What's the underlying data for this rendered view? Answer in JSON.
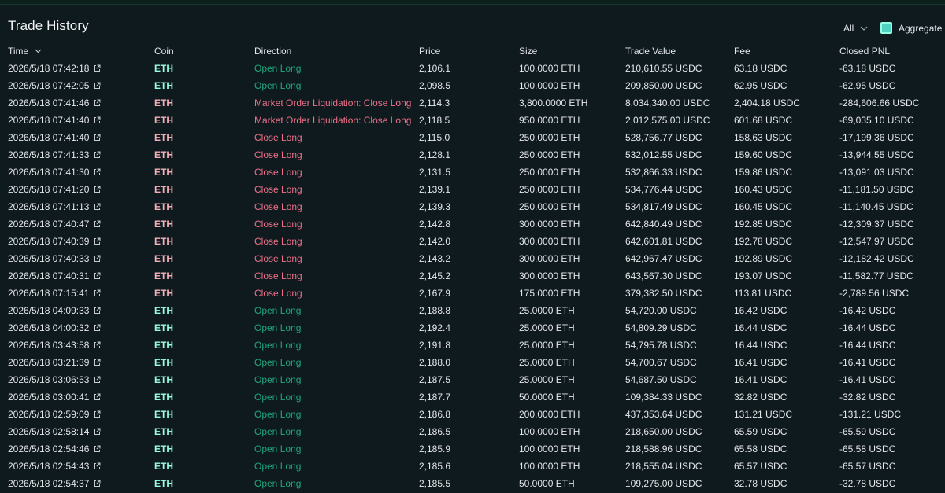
{
  "header": {
    "title": "Trade History",
    "filter_label": "All",
    "aggregate_label": "Aggregate"
  },
  "columns": {
    "time": "Time",
    "coin": "Coin",
    "direction": "Direction",
    "price": "Price",
    "size": "Size",
    "trade_value": "Trade Value",
    "fee": "Fee",
    "closed_pnl": "Closed PNL"
  },
  "colors": {
    "background": "#0f1a1f",
    "long_coin": "#97fce4",
    "short_coin": "#f6b0b7",
    "long_direction": "#1fa67d",
    "short_direction": "#ed7088",
    "accent": "#50d2c1"
  },
  "icons": {
    "external_link": "external-link-icon",
    "dropdown": "chevron-down-icon",
    "sort": "chevron-down-icon"
  },
  "rows": [
    {
      "time": "2026/5/18 07:42:18",
      "coin": "ETH",
      "direction": "Open Long",
      "side": "long",
      "price": "2,106.1",
      "size": "100.0000 ETH",
      "value": "210,610.55 USDC",
      "fee": "63.18 USDC",
      "pnl": "-63.18 USDC"
    },
    {
      "time": "2026/5/18 07:42:05",
      "coin": "ETH",
      "direction": "Open Long",
      "side": "long",
      "price": "2,098.5",
      "size": "100.0000 ETH",
      "value": "209,850.00 USDC",
      "fee": "62.95 USDC",
      "pnl": "-62.95 USDC"
    },
    {
      "time": "2026/5/18 07:41:46",
      "coin": "ETH",
      "direction": "Market Order Liquidation: Close Long",
      "side": "short",
      "price": "2,114.3",
      "size": "3,800.0000 ETH",
      "value": "8,034,340.00 USDC",
      "fee": "2,404.18 USDC",
      "pnl": "-284,606.66 USDC"
    },
    {
      "time": "2026/5/18 07:41:40",
      "coin": "ETH",
      "direction": "Market Order Liquidation: Close Long",
      "side": "short",
      "price": "2,118.5",
      "size": "950.0000 ETH",
      "value": "2,012,575.00 USDC",
      "fee": "601.68 USDC",
      "pnl": "-69,035.10 USDC"
    },
    {
      "time": "2026/5/18 07:41:40",
      "coin": "ETH",
      "direction": "Close Long",
      "side": "short",
      "price": "2,115.0",
      "size": "250.0000 ETH",
      "value": "528,756.77 USDC",
      "fee": "158.63 USDC",
      "pnl": "-17,199.36 USDC"
    },
    {
      "time": "2026/5/18 07:41:33",
      "coin": "ETH",
      "direction": "Close Long",
      "side": "short",
      "price": "2,128.1",
      "size": "250.0000 ETH",
      "value": "532,012.55 USDC",
      "fee": "159.60 USDC",
      "pnl": "-13,944.55 USDC"
    },
    {
      "time": "2026/5/18 07:41:30",
      "coin": "ETH",
      "direction": "Close Long",
      "side": "short",
      "price": "2,131.5",
      "size": "250.0000 ETH",
      "value": "532,866.33 USDC",
      "fee": "159.86 USDC",
      "pnl": "-13,091.03 USDC"
    },
    {
      "time": "2026/5/18 07:41:20",
      "coin": "ETH",
      "direction": "Close Long",
      "side": "short",
      "price": "2,139.1",
      "size": "250.0000 ETH",
      "value": "534,776.44 USDC",
      "fee": "160.43 USDC",
      "pnl": "-11,181.50 USDC"
    },
    {
      "time": "2026/5/18 07:41:13",
      "coin": "ETH",
      "direction": "Close Long",
      "side": "short",
      "price": "2,139.3",
      "size": "250.0000 ETH",
      "value": "534,817.49 USDC",
      "fee": "160.45 USDC",
      "pnl": "-11,140.45 USDC"
    },
    {
      "time": "2026/5/18 07:40:47",
      "coin": "ETH",
      "direction": "Close Long",
      "side": "short",
      "price": "2,142.8",
      "size": "300.0000 ETH",
      "value": "642,840.49 USDC",
      "fee": "192.85 USDC",
      "pnl": "-12,309.37 USDC"
    },
    {
      "time": "2026/5/18 07:40:39",
      "coin": "ETH",
      "direction": "Close Long",
      "side": "short",
      "price": "2,142.0",
      "size": "300.0000 ETH",
      "value": "642,601.81 USDC",
      "fee": "192.78 USDC",
      "pnl": "-12,547.97 USDC"
    },
    {
      "time": "2026/5/18 07:40:33",
      "coin": "ETH",
      "direction": "Close Long",
      "side": "short",
      "price": "2,143.2",
      "size": "300.0000 ETH",
      "value": "642,967.47 USDC",
      "fee": "192.89 USDC",
      "pnl": "-12,182.42 USDC"
    },
    {
      "time": "2026/5/18 07:40:31",
      "coin": "ETH",
      "direction": "Close Long",
      "side": "short",
      "price": "2,145.2",
      "size": "300.0000 ETH",
      "value": "643,567.30 USDC",
      "fee": "193.07 USDC",
      "pnl": "-11,582.77 USDC"
    },
    {
      "time": "2026/5/18 07:15:41",
      "coin": "ETH",
      "direction": "Close Long",
      "side": "short",
      "price": "2,167.9",
      "size": "175.0000 ETH",
      "value": "379,382.50 USDC",
      "fee": "113.81 USDC",
      "pnl": "-2,789.56 USDC"
    },
    {
      "time": "2026/5/18 04:09:33",
      "coin": "ETH",
      "direction": "Open Long",
      "side": "long",
      "price": "2,188.8",
      "size": "25.0000 ETH",
      "value": "54,720.00 USDC",
      "fee": "16.42 USDC",
      "pnl": "-16.42 USDC"
    },
    {
      "time": "2026/5/18 04:00:32",
      "coin": "ETH",
      "direction": "Open Long",
      "side": "long",
      "price": "2,192.4",
      "size": "25.0000 ETH",
      "value": "54,809.29 USDC",
      "fee": "16.44 USDC",
      "pnl": "-16.44 USDC"
    },
    {
      "time": "2026/5/18 03:43:58",
      "coin": "ETH",
      "direction": "Open Long",
      "side": "long",
      "price": "2,191.8",
      "size": "25.0000 ETH",
      "value": "54,795.78 USDC",
      "fee": "16.44 USDC",
      "pnl": "-16.44 USDC"
    },
    {
      "time": "2026/5/18 03:21:39",
      "coin": "ETH",
      "direction": "Open Long",
      "side": "long",
      "price": "2,188.0",
      "size": "25.0000 ETH",
      "value": "54,700.67 USDC",
      "fee": "16.41 USDC",
      "pnl": "-16.41 USDC"
    },
    {
      "time": "2026/5/18 03:06:53",
      "coin": "ETH",
      "direction": "Open Long",
      "side": "long",
      "price": "2,187.5",
      "size": "25.0000 ETH",
      "value": "54,687.50 USDC",
      "fee": "16.41 USDC",
      "pnl": "-16.41 USDC"
    },
    {
      "time": "2026/5/18 03:00:41",
      "coin": "ETH",
      "direction": "Open Long",
      "side": "long",
      "price": "2,187.7",
      "size": "50.0000 ETH",
      "value": "109,384.33 USDC",
      "fee": "32.82 USDC",
      "pnl": "-32.82 USDC"
    },
    {
      "time": "2026/5/18 02:59:09",
      "coin": "ETH",
      "direction": "Open Long",
      "side": "long",
      "price": "2,186.8",
      "size": "200.0000 ETH",
      "value": "437,353.64 USDC",
      "fee": "131.21 USDC",
      "pnl": "-131.21 USDC"
    },
    {
      "time": "2026/5/18 02:58:14",
      "coin": "ETH",
      "direction": "Open Long",
      "side": "long",
      "price": "2,186.5",
      "size": "100.0000 ETH",
      "value": "218,650.00 USDC",
      "fee": "65.59 USDC",
      "pnl": "-65.59 USDC"
    },
    {
      "time": "2026/5/18 02:54:46",
      "coin": "ETH",
      "direction": "Open Long",
      "side": "long",
      "price": "2,185.9",
      "size": "100.0000 ETH",
      "value": "218,588.96 USDC",
      "fee": "65.58 USDC",
      "pnl": "-65.58 USDC"
    },
    {
      "time": "2026/5/18 02:54:43",
      "coin": "ETH",
      "direction": "Open Long",
      "side": "long",
      "price": "2,185.6",
      "size": "100.0000 ETH",
      "value": "218,555.04 USDC",
      "fee": "65.57 USDC",
      "pnl": "-65.57 USDC"
    },
    {
      "time": "2026/5/18 02:54:37",
      "coin": "ETH",
      "direction": "Open Long",
      "side": "long",
      "price": "2,185.5",
      "size": "50.0000 ETH",
      "value": "109,275.00 USDC",
      "fee": "32.78 USDC",
      "pnl": "-32.78 USDC"
    }
  ]
}
